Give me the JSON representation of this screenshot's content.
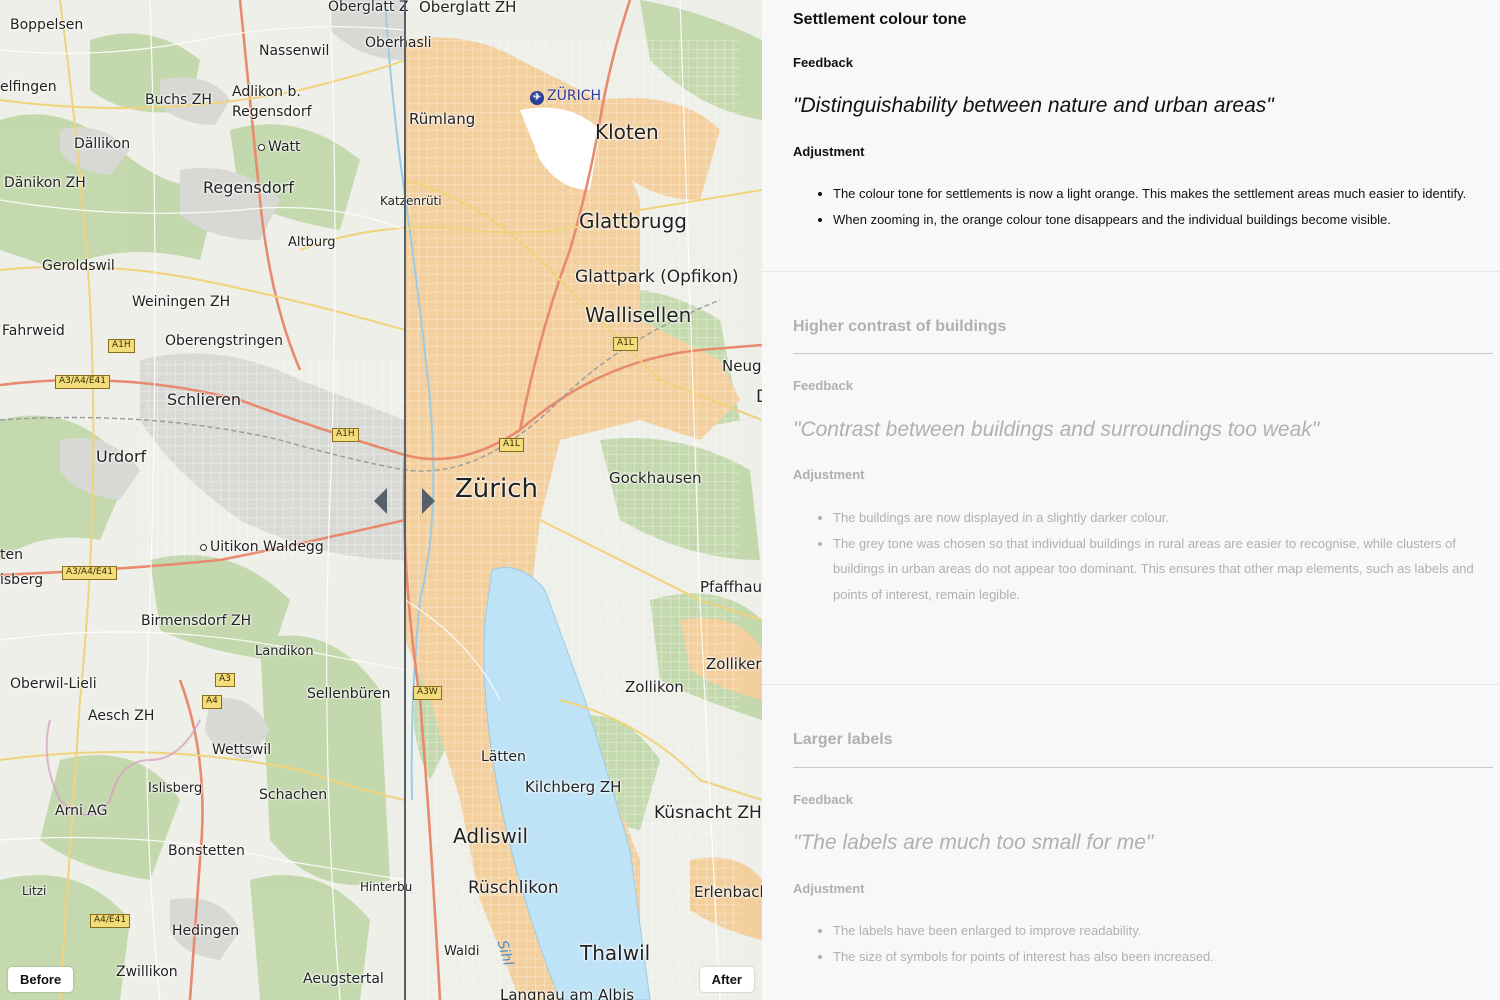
{
  "map": {
    "before_label": "Before",
    "after_label": "After",
    "places_before": {
      "boppelsen": "Boppelsen",
      "elfingen": "elfingen",
      "nassenwil": "Nassenwil",
      "buchs": "Buchs ZH",
      "adlikon1": "Adlikon b.",
      "adlikon2": "Regensdorf",
      "dallikon": "Dällikon",
      "watt": "Watt",
      "danikon": "Dänikon ZH",
      "regensdorf": "Regensdorf",
      "katzenruti": "Katzenrüti",
      "altburg": "Altburg",
      "geroldswil": "Geroldswil",
      "weiningen": "Weiningen ZH",
      "fahrweid": "Fahrweid",
      "oberengstringen": "Oberengstringen",
      "schlieren": "Schlieren",
      "urdorf": "Urdorf",
      "uitikon": "Uitikon Waldegg",
      "ten": "ten",
      "isberg": "isberg",
      "birmensdorf": "Birmensdorf ZH",
      "landikon": "Landikon",
      "oberwil": "Oberwil-Lieli",
      "sellenburen": "Sellenbüren",
      "aesch": "Aesch ZH",
      "wettswil": "Wettswil",
      "islisberg": "Islisberg",
      "schachen": "Schachen",
      "arni": "Arni AG",
      "bonstetten": "Bonstetten",
      "litzi": "Litzi",
      "hinterbu": "Hinterbu",
      "hedingen": "Hedingen",
      "zwillikon": "Zwillikon",
      "aeugstertal": "Aeugstertal",
      "oberglatt": "Oberglatt Z",
      "oberhasli": "Oberhasli"
    },
    "places_after": {
      "oberglatt": "Oberglatt ZH",
      "rumlang": "Rümlang",
      "kloten": "Kloten",
      "glattbrugg": "Glattbrugg",
      "glattpark": "Glattpark (Opfikon)",
      "wallisellen": "Wallisellen",
      "neugu": "Neugu",
      "d": "D",
      "zurich": "Zürich",
      "gockhausen": "Gockhausen",
      "pfaffhaus": "Pfaffhaus",
      "zollikerb": "Zollikerb",
      "zollikon": "Zollikon",
      "latten": "Lätten",
      "kilchberg": "Kilchberg ZH",
      "kusnacht": "Küsnacht ZH",
      "adliswil": "Adliswil",
      "ruschlikon": "Rüschlikon",
      "erlenbach": "Erlenbach",
      "waldi": "Waldi",
      "thalwil": "Thalwil",
      "langnau": "Langnau am Albis"
    },
    "airport": "ZÜRICH",
    "river": "Sihl",
    "shields": {
      "a1h_1": "A1H",
      "a1h_2": "A1H",
      "a3a4e41_1": "A3/A4/E41",
      "a3a4e41_2": "A3/A4/E41",
      "a3": "A3",
      "a4": "A4",
      "a4e41": "A4/E41",
      "a1l_1": "A1L",
      "a1l_2": "A1L",
      "a3w": "A3W"
    },
    "colors": {
      "before_settlement": "#d9d9d6",
      "after_settlement": "#f3cf9c",
      "forest": "#b9d4a0",
      "lake": "#bfe3f6",
      "highway": "#e88a6e",
      "main_road": "#f6d77a"
    }
  },
  "panel": {
    "sections": [
      {
        "title": "Settlement colour tone",
        "feedback_label": "Feedback",
        "quote": "\"Distinguishability between nature and urban areas\"",
        "adjustment_label": "Adjustment",
        "items": [
          "The colour tone for settlements is now a light orange. This makes the settlement areas much easier to identify.",
          "When zooming in, the orange colour tone disappears and the individual buildings become visible."
        ],
        "state": "active"
      },
      {
        "title": "Higher contrast of buildings",
        "feedback_label": "Feedback",
        "quote": "\"Contrast between buildings and surroundings too weak\"",
        "adjustment_label": "Adjustment",
        "items": [
          "The buildings are now displayed in a slightly darker colour.",
          "The grey tone was chosen so that individual buildings in rural areas are easier to recognise, while clusters of buildings in urban areas do not appear too dominant. This ensures that other map elements, such as labels and points of interest, remain legible."
        ],
        "state": "inactive"
      },
      {
        "title": "Larger labels",
        "feedback_label": "Feedback",
        "quote": "\"The labels are much too small for me\"",
        "adjustment_label": "Adjustment",
        "items": [
          "The labels have been enlarged to improve readability.",
          "The size of symbols for points of interest has also been increased."
        ],
        "state": "inactive"
      }
    ]
  }
}
